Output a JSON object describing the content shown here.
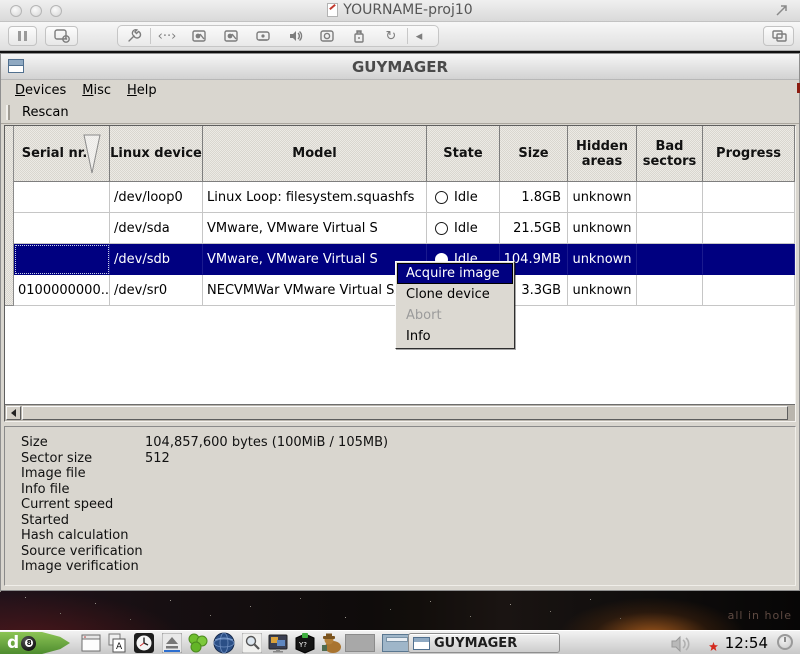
{
  "colors": {
    "selection": "#000080",
    "menu_highlight": "#000080",
    "window_bg": "#d9d6cf",
    "header_bg": "#e4e1da"
  },
  "mac": {
    "title": "YOURNAME-proj10",
    "toolbar_icons": [
      "pause",
      "display-settings",
      "wrench",
      "ctrl-keys",
      "hard-disk-1",
      "hard-disk-2",
      "cd-drive",
      "sound",
      "camera",
      "usb-device",
      "network-sync",
      "collapse-chevron",
      "copy-windows"
    ]
  },
  "app": {
    "title": "GUYMAGER",
    "menus": [
      {
        "accel": "D",
        "rest": "evices"
      },
      {
        "accel": "M",
        "rest": "isc"
      },
      {
        "accel": "H",
        "rest": "elp"
      }
    ],
    "toolbar": {
      "rescan_label": "Rescan"
    },
    "table": {
      "headers": [
        "Serial nr.",
        "Linux device",
        "Model",
        "State",
        "Size",
        "Hidden areas",
        "Bad sectors",
        "Progress"
      ],
      "selected_row_index": 2,
      "rows": [
        {
          "cells": [
            "",
            "/dev/loop0",
            "Linux Loop: filesystem.squashfs",
            "Idle",
            "1.8GB",
            "unknown",
            "",
            ""
          ]
        },
        {
          "cells": [
            "",
            "/dev/sda",
            "VMware, VMware Virtual S",
            "Idle",
            "21.5GB",
            "unknown",
            "",
            ""
          ]
        },
        {
          "cells": [
            "",
            "/dev/sdb",
            "VMware, VMware Virtual S",
            "Idle",
            "104.9MB",
            "unknown",
            "",
            ""
          ]
        },
        {
          "cells": [
            "0100000000...",
            "/dev/sr0",
            "NECVMWar VMware Virtual SAT",
            "",
            "3.3GB",
            "unknown",
            "",
            ""
          ]
        }
      ]
    },
    "info_panel": {
      "rows": [
        {
          "label": "Size",
          "value": "104,857,600 bytes (100MiB / 105MB)"
        },
        {
          "label": "Sector size",
          "value": "512"
        },
        {
          "label": "Image file",
          "value": ""
        },
        {
          "label": "Info file",
          "value": ""
        },
        {
          "label": "Current speed",
          "value": ""
        },
        {
          "label": "Started",
          "value": ""
        },
        {
          "label": "Hash calculation",
          "value": ""
        },
        {
          "label": "Source verification",
          "value": ""
        },
        {
          "label": "Image verification",
          "value": ""
        }
      ]
    }
  },
  "context_menu": {
    "items": [
      {
        "label": "Acquire image",
        "state": "highlighted"
      },
      {
        "label": "Clone device",
        "state": "normal"
      },
      {
        "label": "Abort",
        "state": "disabled"
      },
      {
        "label": "Info",
        "state": "normal"
      }
    ]
  },
  "desktop": {
    "wallpaper_text": "all in hole"
  },
  "taskbar": {
    "launcher_icons": [
      "deft-menu",
      "show-desktop",
      "keyboard-layout",
      "clock",
      "mount-eject",
      "package-manager",
      "network-globe",
      "file-search",
      "image-viewer",
      "crypto-tools",
      "sleuth-tool"
    ],
    "workspaces": [
      "workspace-1",
      "workspace-2"
    ],
    "app_button": "GUYMAGER",
    "tray_icons": [
      "volume",
      "notification",
      "power"
    ],
    "clock": "12:54"
  }
}
